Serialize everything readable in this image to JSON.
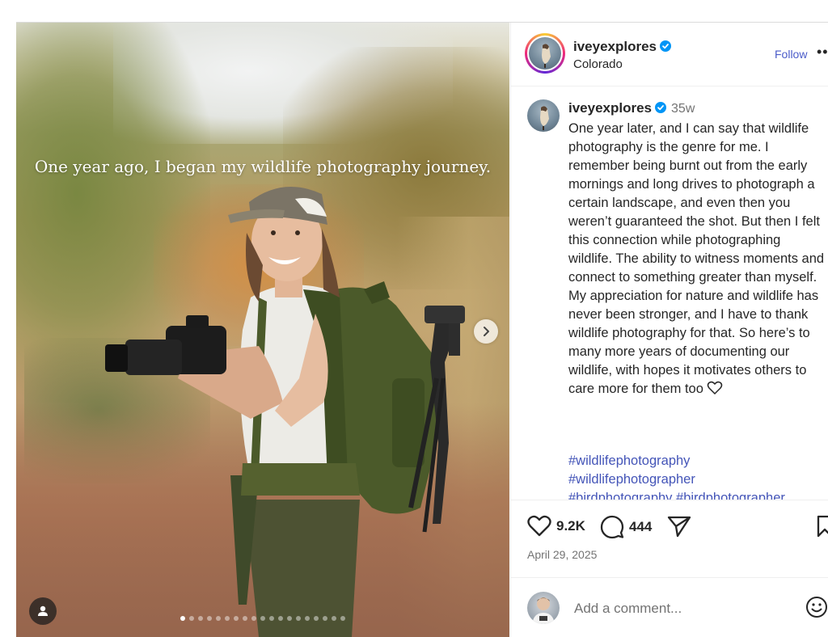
{
  "post": {
    "overlay_text": "One year ago, I began my wildlife photography journey.",
    "carousel": {
      "total_slides": 19,
      "current_slide": 1
    }
  },
  "header": {
    "username": "iveyexplores",
    "location": "Colorado",
    "follow_label": "Follow",
    "more_label": "••"
  },
  "caption": {
    "username": "iveyexplores",
    "time": "35w",
    "text": "One year later, and I can say that wildlife photography is the genre for me. I remember being burnt out from the early mornings and long drives to photograph a certain landscape, and even then you weren’t guaranteed the shot. But then I felt this connection while photographing wildlife. The ability to witness moments and connect to something greater than myself. My appreciation for nature and wildlife has never been stronger, and I have to thank wildlife photography for that. So here’s to many more years of documenting our wildlife, with hopes it motivates others to care more for them too",
    "hashtags": [
      "#wildlifephotography",
      "#wildlifephotographer",
      "#birdphotography",
      "#birdphotographer"
    ]
  },
  "actions": {
    "likes": "9.2K",
    "comments": "444",
    "date": "April 29, 2025"
  },
  "comment_box": {
    "placeholder": "Add a comment..."
  },
  "colors": {
    "link": "#4455b8",
    "follow": "#4a5bc9",
    "verified": "#0095f6",
    "muted": "#737373"
  },
  "icons": [
    "verified-icon",
    "heart-icon",
    "comment-icon",
    "share-icon",
    "bookmark-icon",
    "chevron-right-icon",
    "user-tag-icon",
    "emoji-icon",
    "more-icon"
  ]
}
